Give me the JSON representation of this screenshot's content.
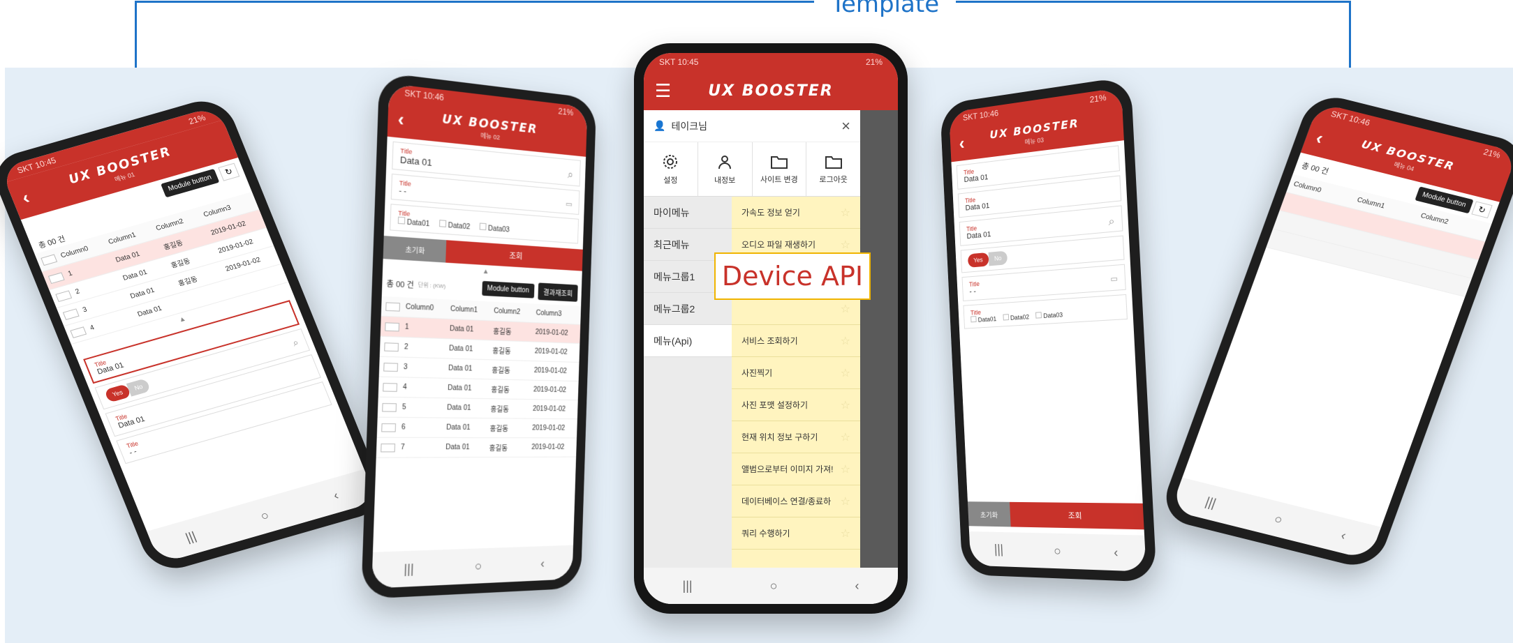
{
  "title_label": "Template",
  "highlight_label": "Device API",
  "colors": {
    "brand": "#c8322a",
    "highlight_border": "#f0b400",
    "bracket": "#1e73c8",
    "background": "#e4eef7",
    "drawer_items": "#fff4bf"
  },
  "logo_text": "UX BOOSTER",
  "center": {
    "status_left": "SKT 10:45",
    "status_right": "21%",
    "user_name": "테이크님",
    "close_icon": "×",
    "icon_items": [
      "설정",
      "내정보",
      "사이트 변경",
      "로그아웃"
    ],
    "categories": [
      "마이메뉴",
      "최근메뉴",
      "메뉴그룹1",
      "메뉴그룹2",
      "메뉴(Api)"
    ],
    "menu_items": [
      "가속도 정보 얻기",
      "오디오 파일 재생하기",
      "",
      "",
      "서비스 조회하기",
      "사진찍기",
      "사진 포맷 설정하기",
      "현재 위치 정보 구하기",
      "앨범으로부터 이미지 가져!",
      "데이터베이스 연결/종료하",
      "쿼리 수행하기"
    ],
    "nav": [
      "|||",
      "○",
      "‹"
    ]
  },
  "left_far": {
    "status_left": "SKT 10:45",
    "status_right": "21%",
    "subtitle": "메뉴 01",
    "module_button": "Module button",
    "count": "총 00 건",
    "columns": [
      "Column0",
      "Column1",
      "Column2",
      "Column3"
    ],
    "rows": [
      [
        "1",
        "Data 01",
        "홍길동",
        "2019-01-02"
      ],
      [
        "2",
        "Data 01",
        "홍길동",
        "2019-01-02"
      ],
      [
        "3",
        "Data 01",
        "홍길동",
        "2019-01-02"
      ],
      [
        "4",
        "Data 01",
        "",
        ""
      ]
    ],
    "field_label": "Title",
    "field_value": "Data 01",
    "toggle_on": "Yes",
    "toggle_off": "No",
    "field2_value": "Data 01",
    "date_placeholder": "- -"
  },
  "left_mid": {
    "status_left": "SKT 10:46",
    "status_right": "21%",
    "subtitle": "메뉴 02",
    "title_label": "Title",
    "title_value": "Data 01",
    "date_placeholder": "- -",
    "checks": [
      "Data01",
      "Data02",
      "Data03"
    ],
    "reset_button": "초기화",
    "search_button": "조회",
    "count": "총 00 건",
    "unit": "단위 : (KW)",
    "module_button": "Module button",
    "result_button": "결과재조회",
    "columns": [
      "Column0",
      "Column1",
      "Column2",
      "Column3"
    ],
    "rows": [
      [
        "1",
        "Data 01",
        "홍길동",
        "2019-01-02"
      ],
      [
        "2",
        "Data 01",
        "홍길동",
        "2019-01-02"
      ],
      [
        "3",
        "Data 01",
        "홍길동",
        "2019-01-02"
      ],
      [
        "4",
        "Data 01",
        "홍길동",
        "2019-01-02"
      ],
      [
        "5",
        "Data 01",
        "홍길동",
        "2019-01-02"
      ],
      [
        "6",
        "Data 01",
        "홍길동",
        "2019-01-02"
      ],
      [
        "7",
        "Data 01",
        "홍길동",
        "2019-01-02"
      ]
    ]
  },
  "right_mid": {
    "status_left": "SKT 10:46",
    "status_right": "21%",
    "subtitle": "메뉴 03",
    "fields": [
      {
        "label": "Title",
        "value": "Data 01"
      },
      {
        "label": "Title",
        "value": "Data 01"
      },
      {
        "label": "Title",
        "value": "Data 01"
      }
    ],
    "toggle_on": "Yes",
    "toggle_off": "No",
    "date_label": "Title",
    "date_placeholder": "- -",
    "check_label": "Title",
    "checks": [
      "Data01",
      "Data02",
      "Data03"
    ],
    "reset_button": "초기화",
    "search_button": "조회"
  },
  "right_far": {
    "status_left": "SKT 10:46",
    "status_right": "21%",
    "subtitle": "메뉴 04",
    "count": "총 00 건",
    "module_button": "Module button",
    "columns": [
      "Column0",
      "Column1",
      "Column2"
    ]
  }
}
